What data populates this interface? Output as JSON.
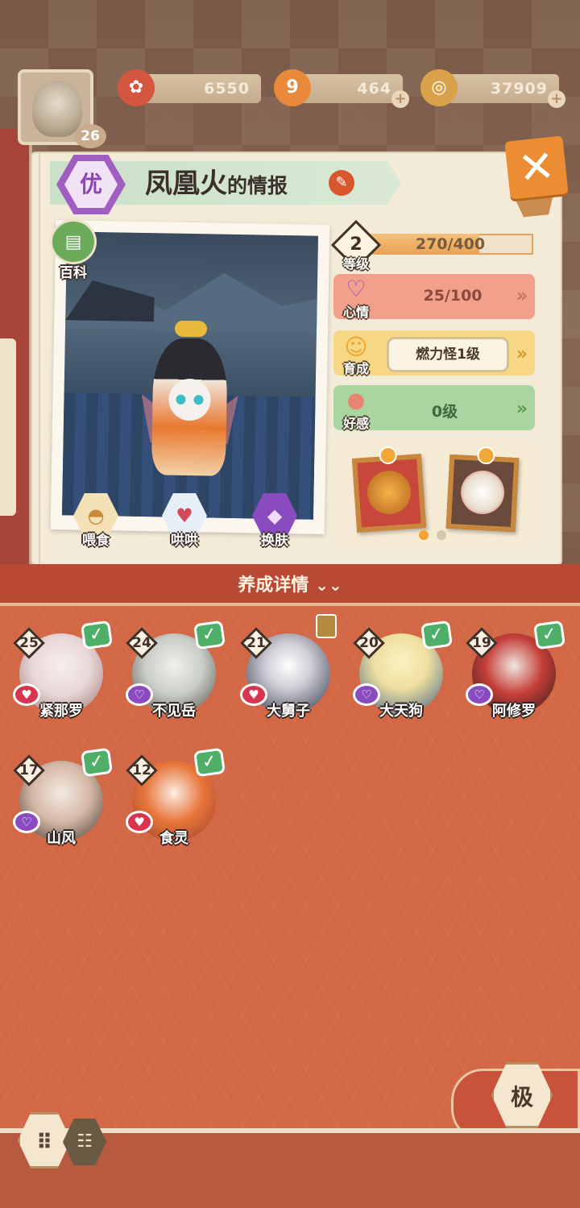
{
  "player": {
    "level": "26"
  },
  "currencies": [
    {
      "icon": "plum-blossom-icon",
      "value": "6550"
    },
    {
      "icon": "magatama-icon",
      "value": "464"
    },
    {
      "icon": "coin-icon",
      "value": "37909"
    }
  ],
  "info_panel": {
    "grade": "优",
    "title_name": "凤凰火",
    "title_suffix": "的情报",
    "baike_label": "百科",
    "actions": [
      {
        "icon": "noodle-bowl-icon",
        "label": "喂食"
      },
      {
        "icon": "milk-carton-icon",
        "label": "哄哄"
      },
      {
        "icon": "outfit-icon",
        "label": "换肤"
      }
    ],
    "stats": {
      "level": {
        "label": "等级",
        "value_num": "2",
        "exp_text": "270/400",
        "exp_fraction": 0.675
      },
      "mood": {
        "label": "心情",
        "value": "25/100"
      },
      "training": {
        "label": "育成",
        "value": "燃力怪1级"
      },
      "affection": {
        "label": "好感",
        "value": "0级"
      }
    },
    "carousel": {
      "pages": 2,
      "active": 1
    }
  },
  "section": {
    "title": "养成详情"
  },
  "shikigami_list": [
    {
      "level": "25",
      "name": "紧那罗",
      "mood": "happy",
      "checked": true
    },
    {
      "level": "24",
      "name": "不见岳",
      "mood": "sad",
      "checked": true
    },
    {
      "level": "21",
      "name": "大舅子",
      "mood": "happy",
      "checked": false
    },
    {
      "level": "20",
      "name": "大天狗",
      "mood": "sad",
      "checked": true
    },
    {
      "level": "19",
      "name": "阿修罗",
      "mood": "sad",
      "checked": true
    },
    {
      "level": "17",
      "name": "山风",
      "mood": "sad",
      "checked": true
    },
    {
      "level": "12",
      "name": "食灵",
      "mood": "happy",
      "checked": true
    }
  ],
  "bottom_bar": {
    "ji_label": "极"
  },
  "colors": {
    "accent_orange": "#e9a155",
    "mood_pink": "#f1a08c",
    "training_yellow": "#f6d783",
    "affection_green": "#a9d6a0",
    "list_bg": "#d26846",
    "check_green": "#4fae68"
  }
}
